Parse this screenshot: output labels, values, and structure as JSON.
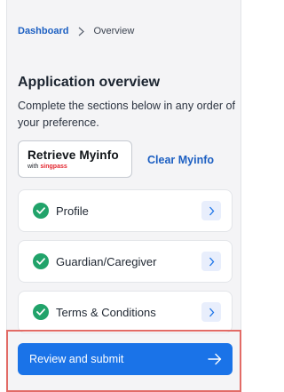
{
  "breadcrumb": {
    "home": "Dashboard",
    "current": "Overview"
  },
  "page": {
    "title": "Application overview",
    "subtitle": "Complete the sections below in any order of your preference."
  },
  "myinfo": {
    "title": "Retrieve Myinfo",
    "sub_prefix": "with ",
    "sub_brand": "singpass",
    "clear_label": "Clear Myinfo"
  },
  "sections": [
    {
      "label": "Profile",
      "status": "complete"
    },
    {
      "label": "Guardian/Caregiver",
      "status": "complete"
    },
    {
      "label": "Terms & Conditions",
      "status": "complete"
    }
  ],
  "submit": {
    "label": "Review and submit"
  },
  "colors": {
    "accent": "#1a73e8",
    "link": "#1c5fc2",
    "success": "#21a36a",
    "highlight": "#e26b66",
    "brand_singpass": "#e3262f"
  },
  "icons": {
    "breadcrumb_separator": "chevron-right-icon",
    "section_status": "check-circle-icon",
    "section_action": "chevron-right-icon",
    "submit_action": "arrow-right-icon"
  }
}
